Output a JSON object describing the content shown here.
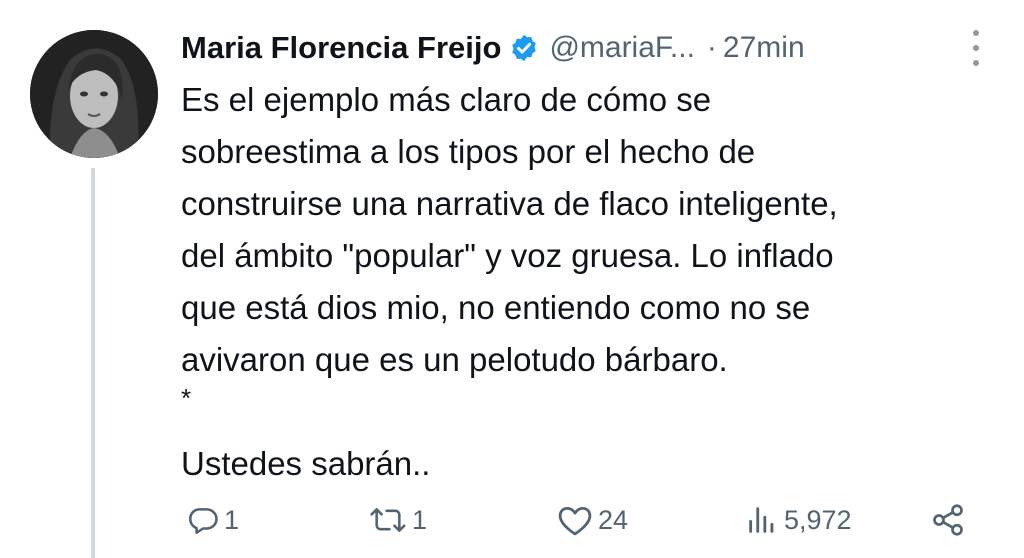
{
  "tweet": {
    "author_name": "Maria Florencia Freijo",
    "handle": "@mariaF...",
    "separator": "·",
    "time": "27min",
    "text_lines": [
      "Es el ejemplo más claro de cómo se",
      "sobreestima a los tipos por el hecho de",
      "construirse una narrativa de flaco inteligente,",
      "del ámbito \"popular\" y voz gruesa. Lo inflado",
      "que está dios mio, no entiendo como no se",
      "avivaron que es un pelotudo bárbaro.",
      "*",
      "Ustedes sabrán.."
    ]
  },
  "actions": {
    "replies": "1",
    "reposts": "1",
    "likes": "24",
    "views": "5,972"
  },
  "icons": {
    "verified": "verified-badge-icon",
    "more": "more-vertical-icon",
    "reply": "reply-icon",
    "repost": "repost-icon",
    "like": "heart-icon",
    "views": "views-icon",
    "share": "share-icon"
  },
  "colors": {
    "text": "#0f1419",
    "secondary": "#536471",
    "verified": "#1d9bf0",
    "thread_line": "#cfd9de"
  }
}
